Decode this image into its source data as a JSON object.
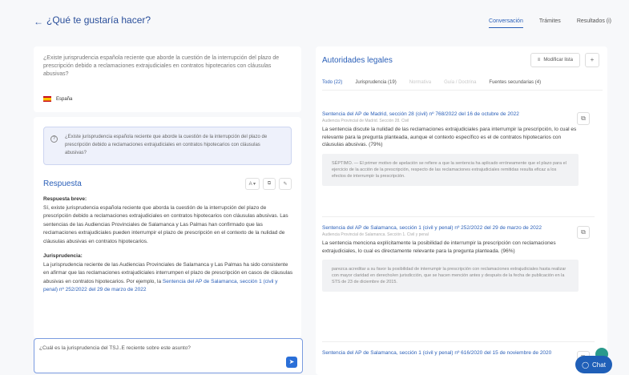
{
  "header": {
    "back_icon": "arrow-left-icon",
    "title": "¿Qué te gustaría hacer?",
    "tabs": [
      {
        "label": "Conversación",
        "active": true
      },
      {
        "label": "Trámites",
        "active": false
      },
      {
        "label": "Resultados (i)",
        "active": false
      }
    ]
  },
  "query": {
    "text": "¿Existe jurisprudencia española reciente que aborde la cuestión de la interrupción del plazo de prescripción debido a reclamaciones extrajudiciales en contratos hipotecarios con cláusulas abusivas?",
    "language": "España",
    "flag_icon": "spain-flag-icon"
  },
  "answer": {
    "question": "¿Existe jurisprudencia española reciente que aborde la cuestión de la interrupción del plazo de prescripción debido a reclamaciones extrajudiciales en contratos hipotecarios con cláusulas abusivas?",
    "title": "Respuesta",
    "actions": [
      "A ▾",
      "⧉",
      "✎"
    ],
    "short_heading": "Respuesta breve:",
    "short_text": "Sí, existe jurisprudencia española reciente que aborda la cuestión de la interrupción del plazo de prescripción debido a reclamaciones extrajudiciales en contratos hipotecarios con cláusulas abusivas. Las sentencias de las Audiencias Provinciales de Salamanca y Las Palmas han confirmado que las reclamaciones extrajudiciales pueden interrumpir el plazo de prescripción en el contexto de la nulidad de cláusulas abusivas en contratos hipotecarios.",
    "juris_heading": "Jurisprudencia:",
    "juris_text": "La jurisprudencia reciente de las Audiencias Provinciales de Salamanca y Las Palmas ha sido consistente en afirmar que las reclamaciones extrajudiciales interrumpen el plazo de prescripción en casos de cláusulas abusivas en contratos hipotecarios. Por ejemplo, la",
    "juris_link": "Sentencia del AP de Salamanca, sección 1 (civil y penal) nº 252/2022 del 29 de marzo de 2022"
  },
  "chat": {
    "placeholder": "¿Cuál es la jurisprudencia del TSJ..E reciente sobre este asunto?",
    "send_icon": "send-arrow-icon"
  },
  "legal": {
    "title": "Autoridades legales",
    "modify_label": "Modificar lista",
    "more_label": "+",
    "tabs": [
      {
        "label": "Todo (22)",
        "state": "active"
      },
      {
        "label": "Jurisprudencia (19)",
        "state": "normal"
      },
      {
        "label": "Normativa",
        "state": "faded"
      },
      {
        "label": "Guía / Doctrina",
        "state": "faded"
      },
      {
        "label": "Fuentes secundarias (4)",
        "state": "normal"
      }
    ],
    "results": [
      {
        "title": "Sentencia del AP de Madrid, sección 28 (civil) nº 768/2022 del 16 de octubre de 2022",
        "court": "Audiencia Provincial de Madrid. Sección 28. Civil",
        "text": "La sentencia discute la nulidad de las reclamaciones extrajudiciales para interrumpir la prescripción, lo cual es relevante para la pregunta planteada, aunque el contexto específico es el de contratos hipotecarios con cláusulas abusivas. (79%)",
        "quote": "SÉPTIMO. — El primer motivo de apelación se refiere a que la sentencia ha aplicado erróneamente que el plazo para el ejercicio de la acción de la prescripción, respecto de las reclamaciones extrajudiciales remitidas resulta eficaz a los efectos de interrumpir la prescripción."
      },
      {
        "title": "Sentencia del AP de Salamanca, sección 1 (civil y penal) nº 252/2022 del 29 de marzo de 2022",
        "court": "Audiencia Provincial de Salamanca. Sección 1. Civil y penal",
        "text": "La sentencia menciona explícitamente la posibilidad de interrumpir la prescripción con reclamaciones extrajudiciales, lo cual es directamente relevante para la pregunta planteada. (96%)",
        "quote": "parezca acreditar a su favor la posibilidad de interrumpir la prescripción con reclamaciones extrajudiciales hasta realizar con mayor claridad en derecho/en jurisdicción, que se hacen mención antes y después de la fecha de publicación en la STS de 23 de diciembre de 2015."
      },
      {
        "title": "Sentencia del AP de Salamanca, sección 1 (civil y penal) nº 616/2020 del 15 de noviembre de 2020",
        "court": "",
        "text": "",
        "quote": ""
      }
    ],
    "result_icon": "copy-icon"
  },
  "fab": {
    "label": "Chat",
    "icon": "chat-bubble-icon"
  }
}
